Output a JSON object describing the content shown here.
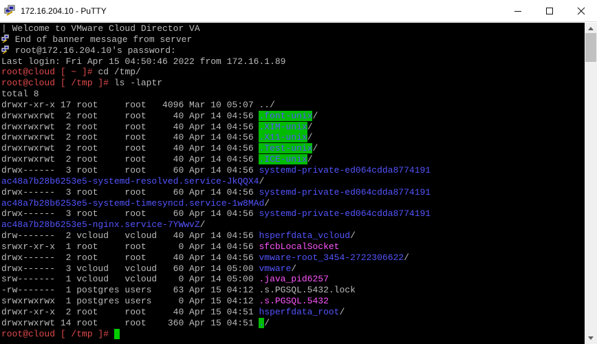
{
  "window": {
    "title": "172.16.204.10 - PuTTY"
  },
  "colors": {
    "default": "#bbbbbb",
    "red": "#e04a4a",
    "blue": "#5454ff",
    "magenta": "#ff55ff",
    "green_bg": "#00bb00",
    "cursor": "#00cc00"
  },
  "terminal": {
    "lines": [
      [
        {
          "t": "| Welcome to VMware Cloud Director VA"
        }
      ],
      [
        {
          "icon": true
        },
        {
          "t": " End of banner message from server"
        }
      ],
      [
        {
          "icon": true
        },
        {
          "t": " root@172.16.204.10's password:"
        }
      ],
      [
        {
          "t": "Last login: Fri Apr 15 04:50:46 2022 from 172.16.1.89"
        }
      ],
      [
        {
          "t": "root@cloud",
          "c": "red"
        },
        {
          "t": " [ ~ ]# ",
          "c": "red"
        },
        {
          "t": "cd /tmp/"
        }
      ],
      [
        {
          "t": "root@cloud",
          "c": "red"
        },
        {
          "t": " [ /tmp ]# ",
          "c": "red"
        },
        {
          "t": "ls -laptr"
        }
      ],
      [
        {
          "t": "total 8"
        }
      ],
      [
        {
          "t": "drwxr-xr-x 17 root     root   4096 Mar 10 05:07 ../"
        }
      ],
      [
        {
          "t": "drwxrwxrwt  2 root     root     40 Apr 14 04:56 "
        },
        {
          "t": ".font-unix",
          "hl": true
        },
        {
          "t": "/"
        }
      ],
      [
        {
          "t": "drwxrwxrwt  2 root     root     40 Apr 14 04:56 "
        },
        {
          "t": ".XIM-unix",
          "hl": true
        },
        {
          "t": "/"
        }
      ],
      [
        {
          "t": "drwxrwxrwt  2 root     root     40 Apr 14 04:56 "
        },
        {
          "t": ".X11-unix",
          "hl": true
        },
        {
          "t": "/"
        }
      ],
      [
        {
          "t": "drwxrwxrwt  2 root     root     40 Apr 14 04:56 "
        },
        {
          "t": ".Test-unix",
          "hl": true
        },
        {
          "t": "/"
        }
      ],
      [
        {
          "t": "drwxrwxrwt  2 root     root     40 Apr 14 04:56 "
        },
        {
          "t": ".ICE-unix",
          "hl": true
        },
        {
          "t": "/"
        }
      ],
      [
        {
          "t": "drwx------  3 root     root     60 Apr 14 04:56 "
        },
        {
          "t": "systemd-private-ed064cdda8774191",
          "c": "blue"
        }
      ],
      [
        {
          "t": "ac48a7b28b6253e5-systemd-resolved.service-JkQQX4",
          "c": "blue"
        },
        {
          "t": "/"
        }
      ],
      [
        {
          "t": "drwx------  3 root     root     60 Apr 14 04:56 "
        },
        {
          "t": "systemd-private-ed064cdda8774191",
          "c": "blue"
        }
      ],
      [
        {
          "t": "ac48a7b28b6253e5-systemd-timesyncd.service-1w8MAd",
          "c": "blue"
        },
        {
          "t": "/"
        }
      ],
      [
        {
          "t": "drwx------  3 root     root     60 Apr 14 04:56 "
        },
        {
          "t": "systemd-private-ed064cdda8774191",
          "c": "blue"
        }
      ],
      [
        {
          "t": "ac48a7b28b6253e5-nginx.service-7YWwvZ",
          "c": "blue"
        },
        {
          "t": "/"
        }
      ],
      [
        {
          "t": "drw-------  2 vcloud   vcloud   40 Apr 14 04:56 "
        },
        {
          "t": "hsperfdata_vcloud",
          "c": "blue"
        },
        {
          "t": "/"
        }
      ],
      [
        {
          "t": "srwxr-xr-x  1 root     root      0 Apr 14 04:56 "
        },
        {
          "t": "sfcbLocalSocket",
          "c": "magenta"
        }
      ],
      [
        {
          "t": "drwx------  2 root     root     40 Apr 14 04:56 "
        },
        {
          "t": "vmware-root_3454-2722306622",
          "c": "blue"
        },
        {
          "t": "/"
        }
      ],
      [
        {
          "t": "drwx------  3 vcloud   vcloud   60 Apr 14 05:00 "
        },
        {
          "t": "vmware",
          "c": "blue"
        },
        {
          "t": "/"
        }
      ],
      [
        {
          "t": "srw-------  1 vcloud   vcloud    0 Apr 14 05:00 "
        },
        {
          "t": ".java_pid6257",
          "c": "magenta"
        }
      ],
      [
        {
          "t": "-rw-------  1 postgres users    63 Apr 15 04:12 .s.PGSQL.5432.lock"
        }
      ],
      [
        {
          "t": "srwxrwxrwx  1 postgres users     0 Apr 15 04:12 "
        },
        {
          "t": ".s.PGSQL.5432",
          "c": "magenta"
        }
      ],
      [
        {
          "t": "drwxr-xr-x  2 root     root     40 Apr 15 04:51 "
        },
        {
          "t": "hsperfdata_root",
          "c": "blue"
        },
        {
          "t": "/"
        }
      ],
      [
        {
          "t": "drwxrwxrwt 14 root     root    360 Apr 15 04:51 "
        },
        {
          "t": ".",
          "hl": true
        },
        {
          "t": "/"
        }
      ],
      [
        {
          "t": "root@cloud",
          "c": "red"
        },
        {
          "t": " [ /tmp ]# ",
          "c": "red"
        },
        {
          "cursor": true
        }
      ]
    ]
  }
}
